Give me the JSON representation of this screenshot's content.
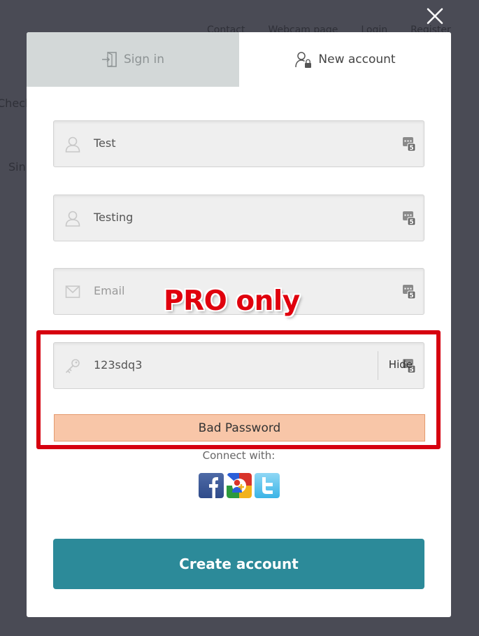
{
  "background": {
    "nav": [
      "Contact",
      "Webcam page",
      "Login",
      "Register"
    ],
    "side_text_1": "Check",
    "side_text_2": "Sin"
  },
  "tabs": {
    "signin_label": "Sign in",
    "newaccount_label": "New account",
    "active": "New account"
  },
  "form": {
    "first_name": {
      "value": "Test",
      "icon": "user-icon"
    },
    "last_name": {
      "value": "Testing",
      "icon": "user-icon"
    },
    "email": {
      "placeholder": "Email",
      "icon": "envelope-icon"
    },
    "password": {
      "value": "123sdq3",
      "icon": "key-icon",
      "toggle_label": "Hide"
    },
    "strength_label": "Bad Password"
  },
  "connect_label": "Connect with:",
  "social": [
    "facebook-icon",
    "google-icon",
    "twitter-icon"
  ],
  "create_button_label": "Create account",
  "annotation": {
    "label": "PRO only",
    "color": "#d6000f"
  },
  "colors": {
    "accent": "#2c8a99",
    "strength_bad": "#f8c6a8",
    "inactive_tab": "#d3d8d8",
    "overlay": "#4a4b55"
  }
}
